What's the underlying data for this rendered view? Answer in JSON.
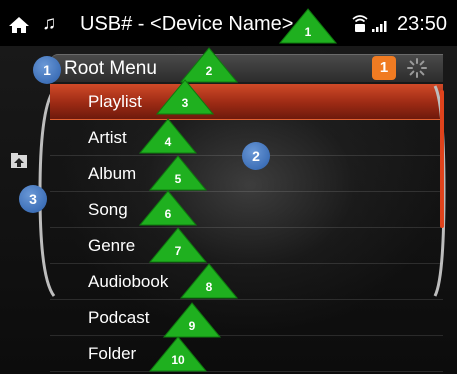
{
  "status_bar": {
    "home_icon": "home-icon",
    "music_icon": "music-note-icon",
    "note_glyph": "♫",
    "source_title": "USB# - <Device Name>",
    "time": "23:50"
  },
  "header": {
    "title": "Root Menu",
    "badge": "1"
  },
  "menu": {
    "items": [
      {
        "label": "Playlist",
        "selected": true
      },
      {
        "label": "Artist"
      },
      {
        "label": "Album"
      },
      {
        "label": "Song"
      },
      {
        "label": "Genre"
      },
      {
        "label": "Audiobook"
      },
      {
        "label": "Podcast"
      },
      {
        "label": "Folder"
      }
    ]
  },
  "scrollbar": {
    "position": 0.0,
    "visible_fraction": 0.65
  },
  "annotations": {
    "circles": [
      "1",
      "2",
      "3"
    ],
    "triangles": [
      "1",
      "2",
      "3",
      "4",
      "5",
      "6",
      "7",
      "8",
      "9",
      "10"
    ]
  },
  "colors": {
    "accent": "#e0431c",
    "badge": "#f07b22",
    "annotation_circle": "#3e70b8",
    "annotation_triangle": "#1fb01f"
  }
}
